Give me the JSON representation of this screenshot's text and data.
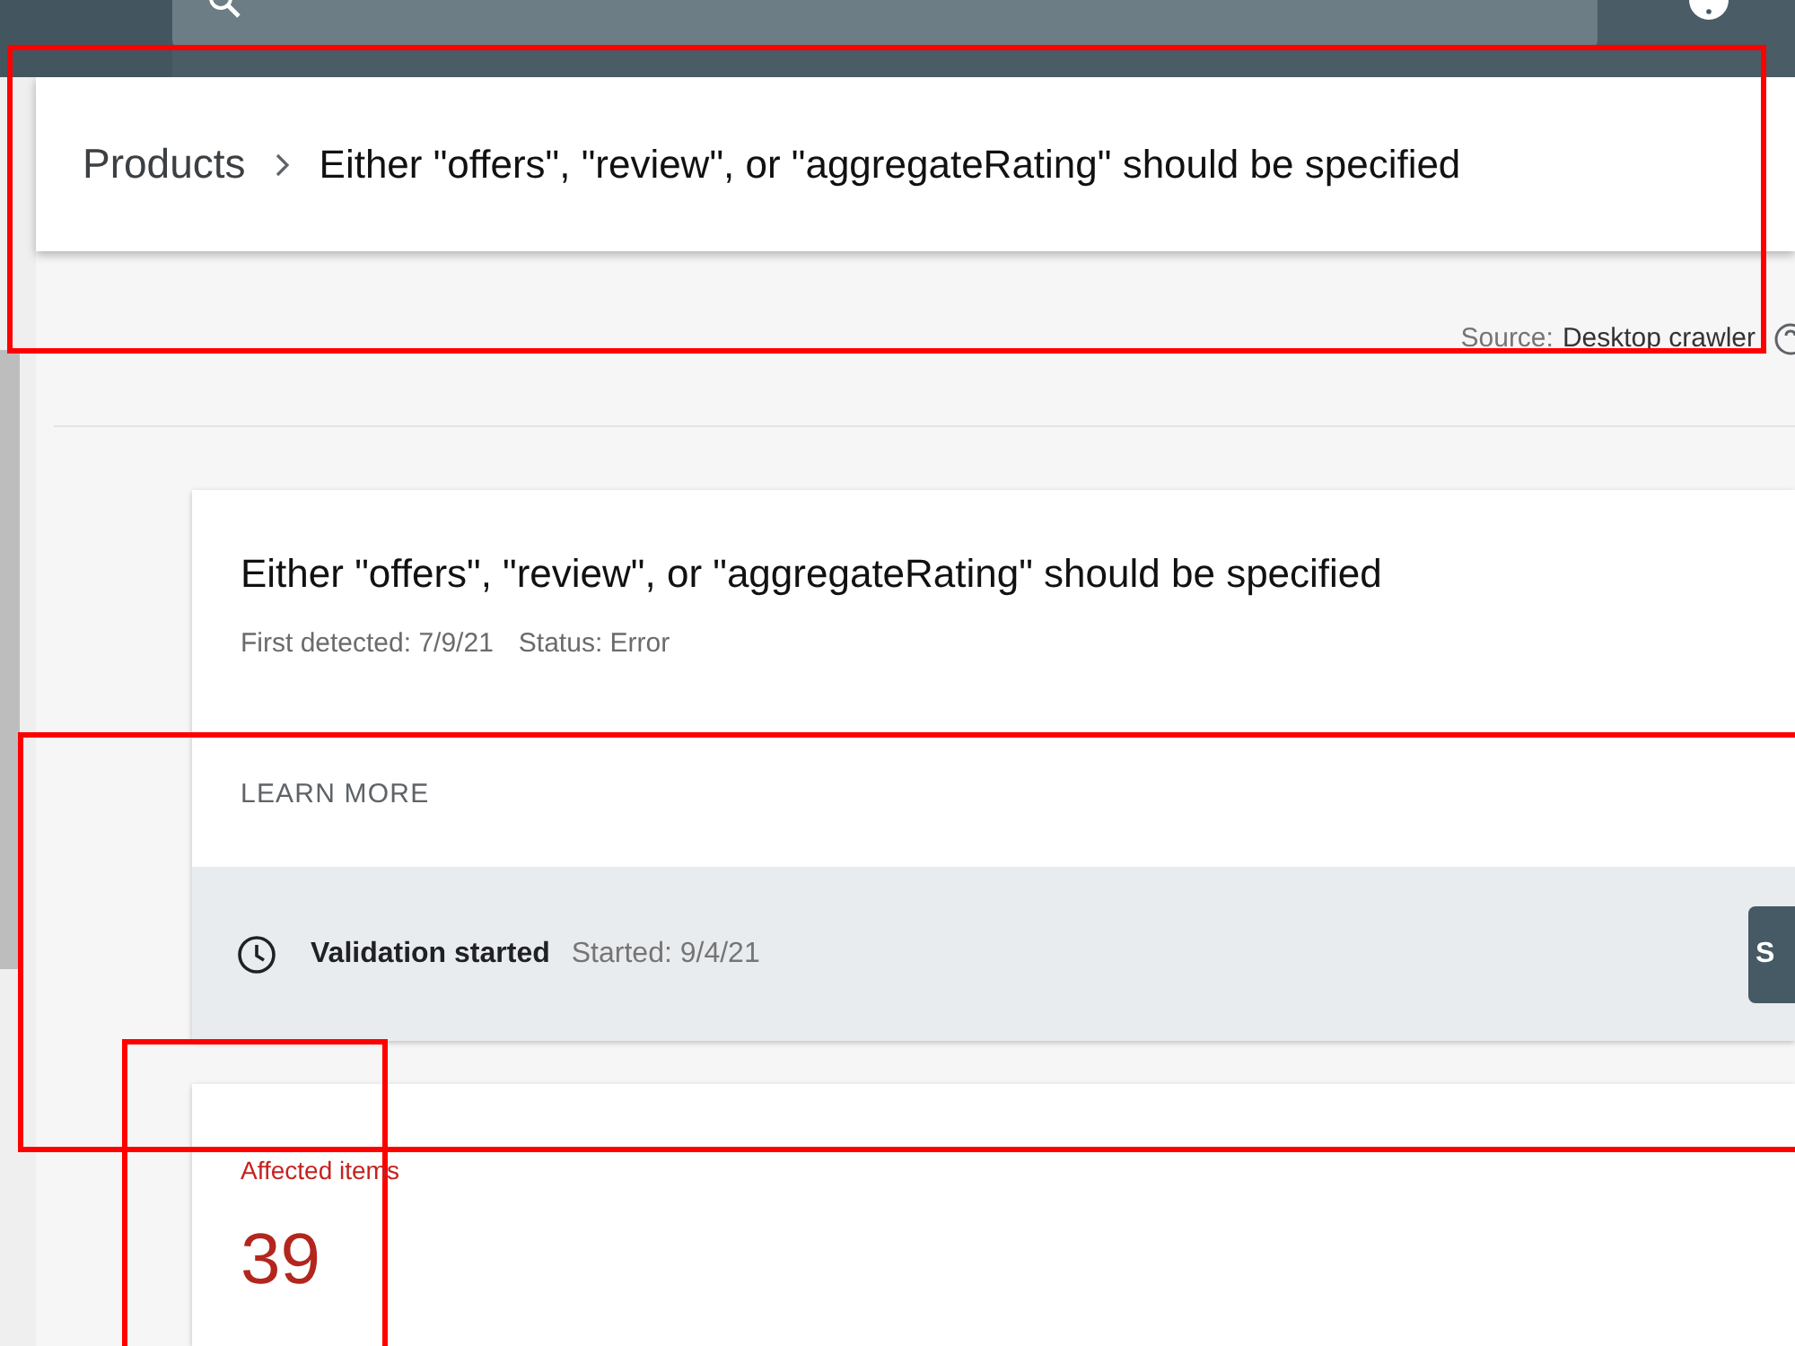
{
  "breadcrumb": {
    "items": [
      "Products",
      "Either \"offers\", \"review\", or \"aggregateRating\" should be specified"
    ],
    "highlighted": true
  },
  "source": {
    "label": "Source:",
    "value": "Desktop crawler"
  },
  "issue_card": {
    "title": "Either \"offers\", \"review\", or \"aggregateRating\" should be specified",
    "details": [
      "First detected: 7/9/21",
      "Status: Error"
    ],
    "learn_more": "LEARN MORE"
  },
  "validation": {
    "status": "Validation started",
    "started": "Started: 9/4/21",
    "button": "S",
    "highlighted": true
  },
  "affected_items": {
    "label": "Affected items",
    "value": "39",
    "highlighted": true
  }
}
